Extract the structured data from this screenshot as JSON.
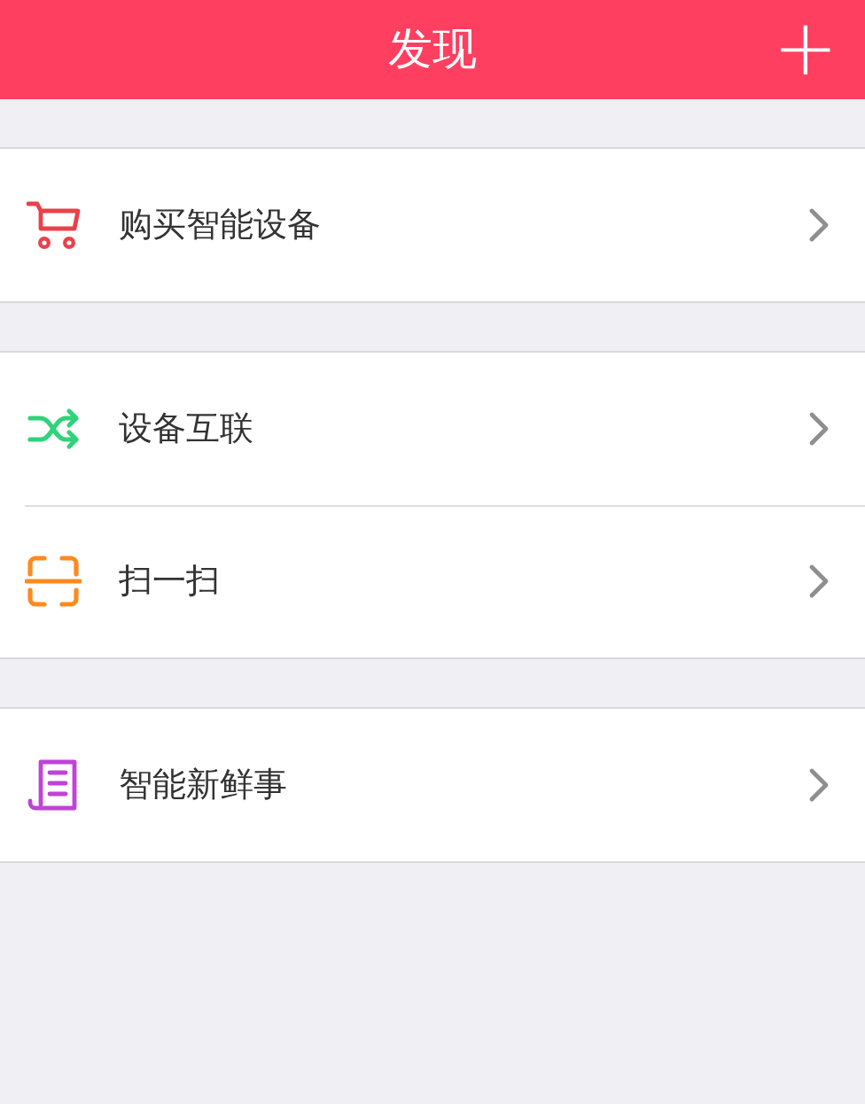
{
  "header": {
    "title": "发现",
    "add_button": "+"
  },
  "groups": [
    {
      "items": [
        {
          "kind": "cart",
          "color": "#e9414a",
          "label": "购买智能设备"
        }
      ]
    },
    {
      "items": [
        {
          "kind": "shuffle",
          "color": "#2fd37a",
          "label": "设备互联"
        },
        {
          "kind": "scan",
          "color": "#ff8a1e",
          "label": "扫一扫"
        }
      ]
    },
    {
      "items": [
        {
          "kind": "news",
          "color": "#c043d6",
          "label": "智能新鲜事"
        }
      ]
    }
  ]
}
